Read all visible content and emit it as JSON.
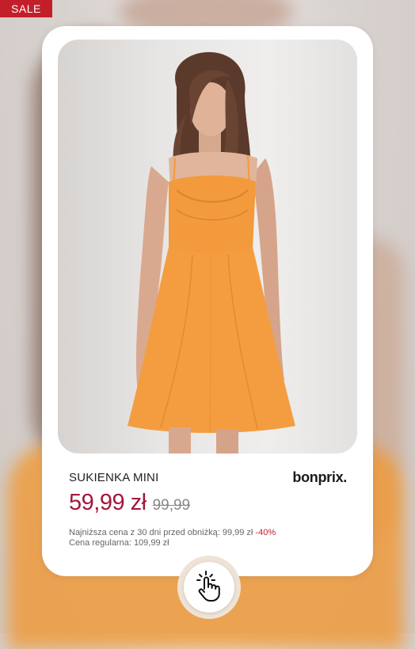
{
  "badge": {
    "label": "SALE"
  },
  "product": {
    "name": "SUKIENKA MINI",
    "brand": "bonprix.",
    "price_current": "59,99 zł",
    "price_old": "99,99",
    "lowest_price_text": "Najniższa cena z 30 dni przed obniżką: 99,99 zł",
    "discount": "-40%",
    "regular_price_text": "Cena regularna: 109,99 zł",
    "image_alt": "Model in orange mini dress"
  },
  "colors": {
    "sale_red": "#c21f2b",
    "price_red": "#a4173a",
    "dress_orange": "#f39a3d"
  },
  "icons": {
    "tap": "hand-tap-icon"
  }
}
